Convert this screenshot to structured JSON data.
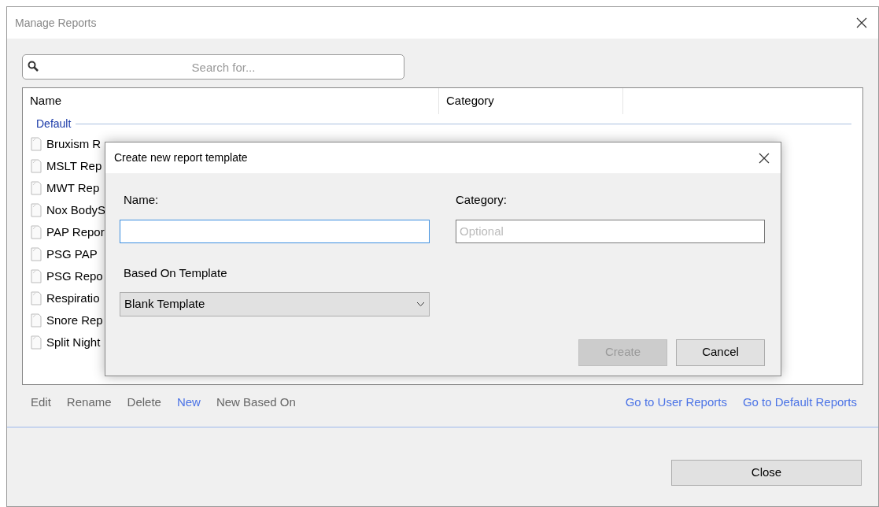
{
  "window": {
    "title": "Manage Reports"
  },
  "search": {
    "placeholder": "Search for..."
  },
  "table": {
    "columns": [
      "Name",
      "Category"
    ],
    "group": "Default",
    "rows": [
      {
        "name": "Bruxism R"
      },
      {
        "name": "MSLT Rep"
      },
      {
        "name": "MWT Rep"
      },
      {
        "name": "Nox BodyS"
      },
      {
        "name": "PAP Repor"
      },
      {
        "name": "PSG PAP"
      },
      {
        "name": "PSG Repo"
      },
      {
        "name": "Respiratio"
      },
      {
        "name": "Snore Rep"
      },
      {
        "name": "Split Night"
      }
    ]
  },
  "actions": [
    {
      "label": "Edit",
      "disabled": true
    },
    {
      "label": "Rename",
      "disabled": true
    },
    {
      "label": "Delete",
      "disabled": true
    },
    {
      "label": "New",
      "disabled": false
    },
    {
      "label": "New Based On",
      "disabled": true
    }
  ],
  "links": [
    "Go to User Reports",
    "Go to Default Reports"
  ],
  "close_button": "Close",
  "dialog": {
    "title": "Create new report template",
    "name_label": "Name:",
    "category_label": "Category:",
    "category_placeholder": "Optional",
    "template_label": "Based On Template",
    "template_value": "Blank Template",
    "buttons": [
      {
        "label": "Create",
        "disabled": true
      },
      {
        "label": "Cancel",
        "disabled": false
      }
    ]
  }
}
